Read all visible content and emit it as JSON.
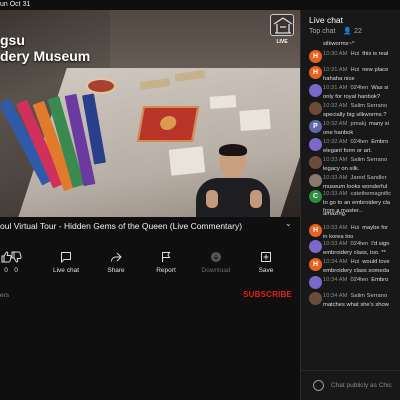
{
  "status_bar": {
    "text": "un Oct 31"
  },
  "video": {
    "banner_line1": "gsu",
    "banner_line2": "dery Museum",
    "logo_label": "LIVE"
  },
  "video_title": "oul Virtual Tour - Hidden Gems of the Queen (Live Commentary)",
  "actions": [
    {
      "label": "0",
      "icon": "thumbs-up-icon"
    },
    {
      "label": "0",
      "icon": "thumbs-down-icon"
    },
    {
      "label": "Live chat",
      "icon": "chat-icon"
    },
    {
      "label": "Share",
      "icon": "share-icon"
    },
    {
      "label": "Report",
      "icon": "flag-icon"
    },
    {
      "label": "Download",
      "icon": "download-icon",
      "disabled": true
    },
    {
      "label": "Save",
      "icon": "save-icon"
    }
  ],
  "subscribers_text": "ers",
  "subscribe_label": "SUBSCRIBE",
  "chat": {
    "title": "Live chat",
    "subtitle": "Top chat",
    "viewer_count": "22",
    "input_placeholder": "Chat publicly as Chic",
    "messages": [
      {
        "time": "",
        "author": "",
        "text": "silkworms~^",
        "avatar": "",
        "color": "#000000"
      },
      {
        "time": "10:30 AM",
        "author": "Hui",
        "text": "this is real",
        "continued": "",
        "avatar": "H",
        "color": "#e8621f"
      },
      {
        "time": "10:31 AM",
        "author": "Hui",
        "text": "new place",
        "continued": "hahaha nice",
        "avatar": "H",
        "color": "#e8621f"
      },
      {
        "time": "10:31 AM",
        "author": "024ten",
        "text": "Was si",
        "continued": "only for royal hanbok?",
        "avatar": "",
        "color": "#7b68c8"
      },
      {
        "time": "10:32 AM",
        "author": "Salim Serrano",
        "text": "",
        "continued": "specially big silkworms.?",
        "avatar": "",
        "color": "#6b4b3a"
      },
      {
        "time": "10:32 AM",
        "author": "pmakj",
        "text": "many si",
        "continued": "one hanbok",
        "avatar": "P",
        "color": "#5e6aa8"
      },
      {
        "time": "10:32 AM",
        "author": "024ten",
        "text": "Embro",
        "continued": "elegant form or art.",
        "avatar": "",
        "color": "#7b68c8"
      },
      {
        "time": "10:33 AM",
        "author": "Salim Serrano",
        "text": "",
        "continued": "legacy on silk.",
        "avatar": "",
        "color": "#6b4b3a"
      },
      {
        "time": "10:33 AM",
        "author": "Jared Sandler",
        "text": "",
        "continued": "museum looks wonderful",
        "avatar": "",
        "color": "#8a7a6e"
      },
      {
        "time": "10:33 AM",
        "author": "catethemagnific",
        "text": "",
        "continued": "to go to an embroidery cla",
        "extra": "from a master...",
        "avatar": "C",
        "color": "#2e8b3f"
      },
      {
        "time": "",
        "author": "",
        "text": "amazing.",
        "avatar": "",
        "color": "#000000"
      },
      {
        "time": "10:33 AM",
        "author": "Hui",
        "text": "maybe for",
        "continued": "in korea too",
        "avatar": "H",
        "color": "#e8621f"
      },
      {
        "time": "10:33 AM",
        "author": "024ten",
        "text": "I'd sign",
        "continued": "embroidery class, too. **",
        "avatar": "",
        "color": "#7b68c8"
      },
      {
        "time": "10:34 AM",
        "author": "Hui",
        "text": "would love",
        "continued": "embroidery class someda",
        "avatar": "H",
        "color": "#e8621f"
      },
      {
        "time": "10:34 AM",
        "author": "024ten",
        "text": "Embro",
        "continued": "",
        "avatar": "",
        "color": "#7b68c8"
      },
      {
        "time": "10:34 AM",
        "author": "Salim Serrano",
        "text": "",
        "continued": "matches what she's show",
        "avatar": "",
        "color": "#6b4b3a"
      }
    ]
  }
}
